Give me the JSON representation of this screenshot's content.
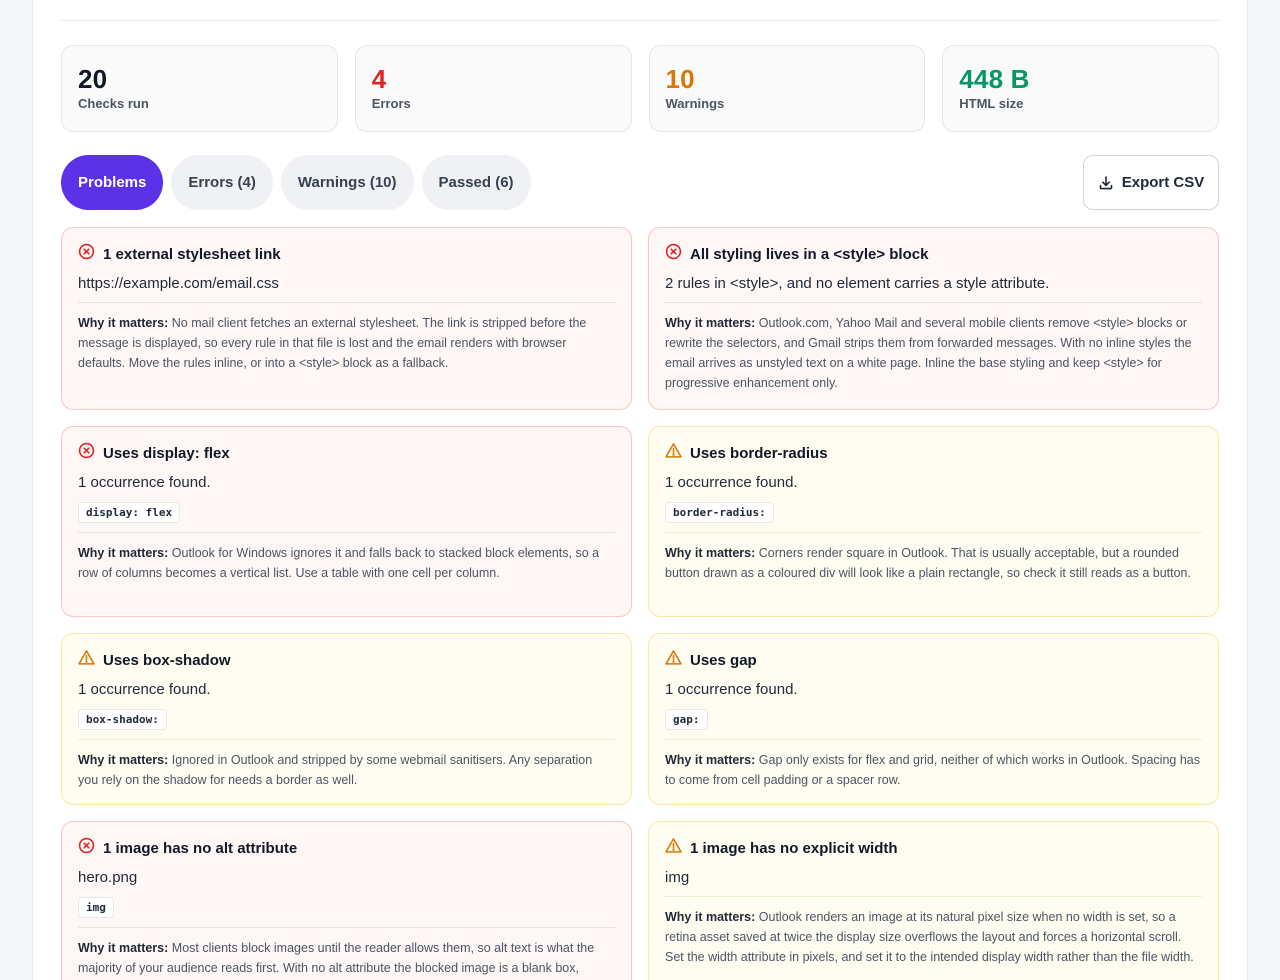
{
  "stats": [
    {
      "value": "20",
      "label": "Checks run",
      "color": "#111827"
    },
    {
      "value": "4",
      "label": "Errors",
      "color": "#dc2626"
    },
    {
      "value": "10",
      "label": "Warnings",
      "color": "#d97706"
    },
    {
      "value": "448 B",
      "label": "HTML size",
      "color": "#059669"
    }
  ],
  "tabs": [
    {
      "label": "Problems",
      "active": true
    },
    {
      "label": "Errors (4)",
      "active": false
    },
    {
      "label": "Warnings (10)",
      "active": false
    },
    {
      "label": "Passed (6)",
      "active": false
    }
  ],
  "export": {
    "label": "Export CSV",
    "icon": "download-icon"
  },
  "why_label": "Why it matters:",
  "cards": [
    {
      "severity": "error",
      "icon": "x-circle-icon",
      "title": "1 external stylesheet link",
      "detail": "https://example.com/email.css",
      "code": "",
      "why": "No mail client fetches an external stylesheet. The link is stripped before the message is displayed, so every rule in that file is lost and the email renders with browser defaults. Move the rules inline, or into a <style> block as a fallback."
    },
    {
      "severity": "error",
      "icon": "x-circle-icon",
      "title": "All styling lives in a <style> block",
      "detail": "2 rules in <style>, and no element carries a style attribute.",
      "code": "",
      "why": "Outlook.com, Yahoo Mail and several mobile clients remove <style> blocks or rewrite the selectors, and Gmail strips them from forwarded messages. With no inline styles the email arrives as unstyled text on a white page. Inline the base styling and keep <style> for progressive enhancement only."
    },
    {
      "severity": "error",
      "icon": "x-circle-icon",
      "title": "Uses display: flex",
      "detail": "1 occurrence found.",
      "code": "display: flex",
      "why": "Outlook for Windows ignores it and falls back to stacked block elements, so a row of columns becomes a vertical list. Use a table with one cell per column."
    },
    {
      "severity": "warn",
      "icon": "warning-triangle-icon",
      "title": "Uses border-radius",
      "detail": "1 occurrence found.",
      "code": "border-radius:",
      "why": "Corners render square in Outlook. That is usually acceptable, but a rounded button drawn as a coloured div will look like a plain rectangle, so check it still reads as a button."
    },
    {
      "severity": "warn",
      "icon": "warning-triangle-icon",
      "title": "Uses box-shadow",
      "detail": "1 occurrence found.",
      "code": "box-shadow:",
      "why": "Ignored in Outlook and stripped by some webmail sanitisers. Any separation you rely on the shadow for needs a border as well."
    },
    {
      "severity": "warn",
      "icon": "warning-triangle-icon",
      "title": "Uses gap",
      "detail": "1 occurrence found.",
      "code": "gap:",
      "why": "Gap only exists for flex and grid, neither of which works in Outlook. Spacing has to come from cell padding or a spacer row."
    },
    {
      "severity": "error",
      "icon": "x-circle-icon",
      "title": "1 image has no alt attribute",
      "detail": "hero.png",
      "code": "img",
      "why": "Most clients block images until the reader allows them, so alt text is what the majority of your audience reads first. With no alt attribute the blocked image is a blank box,"
    },
    {
      "severity": "warn",
      "icon": "warning-triangle-icon",
      "title": "1 image has no explicit width",
      "detail": "img",
      "code": "",
      "why": "Outlook renders an image at its natural pixel size when no width is set, so a retina asset saved at twice the display size overflows the layout and forces a horizontal scroll. Set the width attribute in pixels, and set it to the intended display width rather than the file width."
    }
  ]
}
